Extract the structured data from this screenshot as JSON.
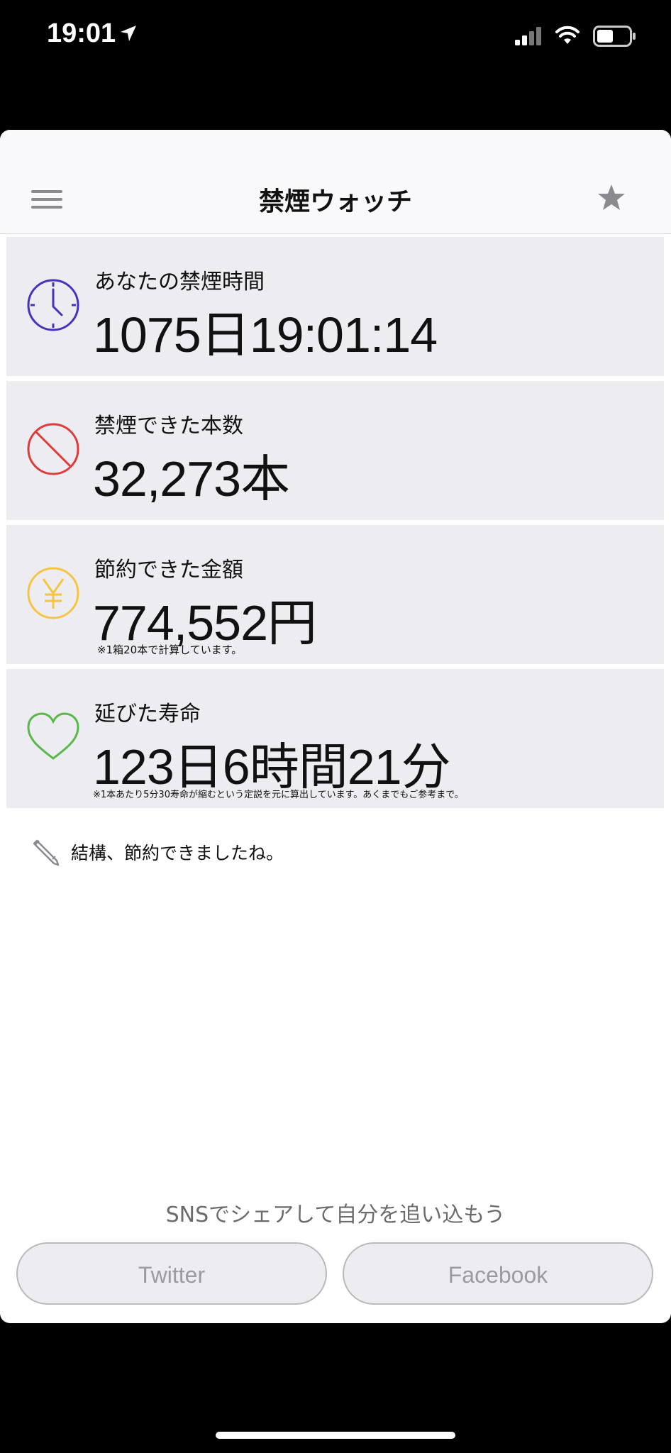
{
  "status_bar": {
    "time": "19:01"
  },
  "nav": {
    "title": "禁煙ウォッチ"
  },
  "stats": [
    {
      "label": "あなたの禁煙時間",
      "value": "1075日19:01:14",
      "icon": "clock-icon",
      "color": "#4a2fc0"
    },
    {
      "label": "禁煙できた本数",
      "value": "32,273本",
      "icon": "prohibited-icon",
      "color": "#e03a3a"
    },
    {
      "label": "節約できた金額",
      "value": "774,552円",
      "note": "※1箱20本で計算しています。",
      "icon": "yen-icon",
      "color": "#f5c542"
    },
    {
      "label": "延びた寿命",
      "value": "123日6時間21分",
      "note": "※1本あたり5分30寿命が縮むという定説を元に算出しています。あくまでもご参考まで。",
      "icon": "heart-icon",
      "color": "#5ab84a"
    }
  ],
  "comment": {
    "text": "結構、節約できましたね。",
    "icon": "pencil-icon"
  },
  "sns": {
    "caption": "SNSでシェアして自分を追い込もう",
    "twitter_label": "Twitter",
    "facebook_label": "Facebook"
  }
}
